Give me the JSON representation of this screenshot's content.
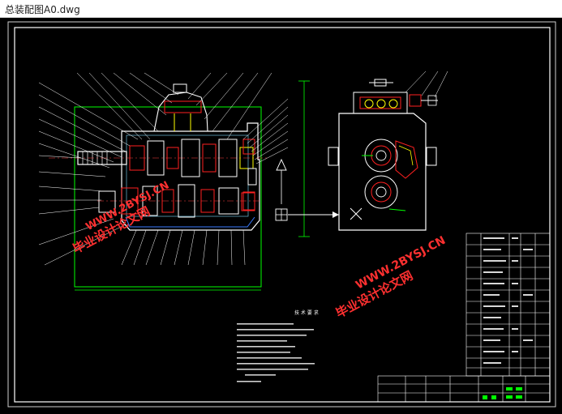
{
  "window": {
    "title": "总装配图A0.dwg"
  },
  "drawing": {
    "background": "#000000",
    "frame_color": "#ffffff",
    "line_colors": {
      "green": "#00ff00",
      "red": "#ff2020",
      "cyan": "#00ffff",
      "yellow": "#ffff00",
      "white": "#ffffff"
    },
    "watermark_text_cn": "毕业设计论文网",
    "watermark_url": "WWW.2BYSJ.CN",
    "watermark_color": "#ff3030",
    "notes_heading": "技 术 要 求"
  }
}
